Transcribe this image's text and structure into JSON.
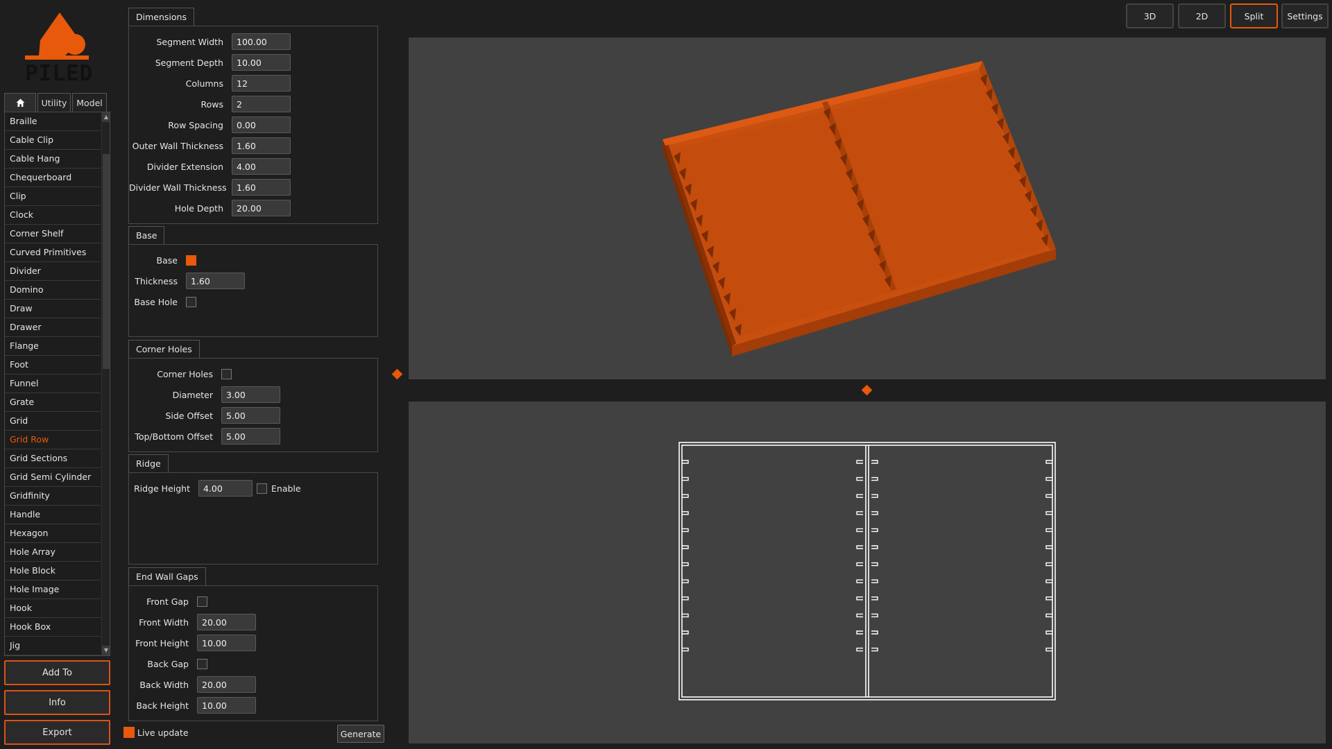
{
  "logo_text": "PILED",
  "left_tabs": {
    "home": "home-icon",
    "utility": "Utility",
    "model": "Model"
  },
  "models": [
    "Braille",
    "Cable Clip",
    "Cable Hang",
    "Chequerboard",
    "Clip",
    "Clock",
    "Corner Shelf",
    "Curved Primitives",
    "Divider",
    "Domino",
    "Draw",
    "Drawer",
    "Flange",
    "Foot",
    "Funnel",
    "Grate",
    "Grid",
    "Grid Row",
    "Grid Sections",
    "Grid Semi Cylinder",
    "Gridfinity",
    "Handle",
    "Hexagon",
    "Hole Array",
    "Hole Block",
    "Hole Image",
    "Hook",
    "Hook Box",
    "Jig"
  ],
  "selected_model": "Grid Row",
  "buttons": {
    "add_to": "Add To",
    "info": "Info",
    "export": "Export",
    "generate": "Generate"
  },
  "live_update": {
    "label": "Live update",
    "checked": true
  },
  "dimensions": {
    "title": "Dimensions",
    "segment_width": {
      "label": "Segment Width",
      "value": "100.00"
    },
    "segment_depth": {
      "label": "Segment Depth",
      "value": "10.00"
    },
    "columns": {
      "label": "Columns",
      "value": "12"
    },
    "rows": {
      "label": "Rows",
      "value": "2"
    },
    "row_spacing": {
      "label": "Row Spacing",
      "value": "0.00"
    },
    "outer_wall": {
      "label": "Outer Wall Thickness",
      "value": "1.60"
    },
    "divider_ext": {
      "label": "Divider Extension",
      "value": "4.00"
    },
    "divider_wall": {
      "label": "Divider Wall Thickness",
      "value": "1.60"
    },
    "hole_depth": {
      "label": "Hole Depth",
      "value": "20.00"
    }
  },
  "base": {
    "title": "Base",
    "base": {
      "label": "Base",
      "checked": true
    },
    "thickness": {
      "label": "Thickness",
      "value": "1.60"
    },
    "base_hole": {
      "label": "Base Hole",
      "checked": false
    }
  },
  "corner_holes": {
    "title": "Corner Holes",
    "enabled": {
      "label": "Corner Holes",
      "checked": false
    },
    "diameter": {
      "label": "Diameter",
      "value": "3.00"
    },
    "side_offset": {
      "label": "Side Offset",
      "value": "5.00"
    },
    "tb_offset": {
      "label": "Top/Bottom Offset",
      "value": "5.00"
    }
  },
  "ridge": {
    "title": "Ridge",
    "height": {
      "label": "Ridge Height",
      "value": "4.00"
    },
    "enable": {
      "label": "Enable",
      "checked": false
    }
  },
  "end_wall_gaps": {
    "title": "End Wall Gaps",
    "front_gap": {
      "label": "Front Gap",
      "checked": false
    },
    "front_width": {
      "label": "Front Width",
      "value": "20.00"
    },
    "front_height": {
      "label": "Front Height",
      "value": "10.00"
    },
    "back_gap": {
      "label": "Back Gap",
      "checked": false
    },
    "back_width": {
      "label": "Back Width",
      "value": "20.00"
    },
    "back_height": {
      "label": "Back Height",
      "value": "10.00"
    }
  },
  "view_buttons": {
    "v3d": "3D",
    "v2d": "2D",
    "split": "Split",
    "settings": "Settings"
  },
  "active_view": "Split",
  "colors": {
    "accent": "#e8590c",
    "model_face": "#c94f0f",
    "viewport_bg": "#414141",
    "app_bg": "#1e1e1e"
  }
}
